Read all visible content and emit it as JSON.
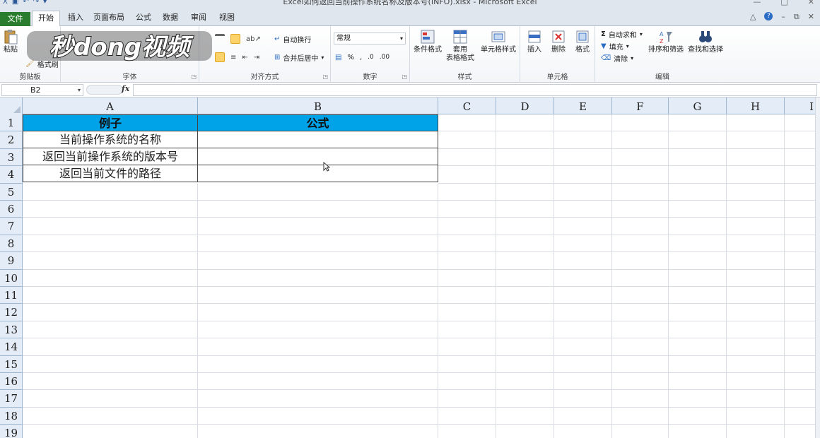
{
  "window": {
    "title": "Excel如何返回当前操作系统名称及版本号(INFO).xlsx - Microsoft Excel",
    "controls": [
      "—",
      "□",
      "✕"
    ]
  },
  "tabs": {
    "file": "文件",
    "items": [
      "开始",
      "插入",
      "页面布局",
      "公式",
      "数据",
      "审阅",
      "视图"
    ]
  },
  "watermark": {
    "text": "秒dong视频"
  },
  "ribbon": {
    "clipboard": {
      "label": "剪贴板",
      "paste": "粘贴",
      "format_painter": "格式刷"
    },
    "font": {
      "label": "字体"
    },
    "alignment": {
      "label": "对齐方式",
      "wrap": "自动换行",
      "merge": "合并后居中"
    },
    "number": {
      "label": "数字",
      "format": "常规"
    },
    "styles": {
      "label": "样式",
      "conditional": "条件格式",
      "table1": "套用",
      "table2": "表格格式",
      "cell_styles": "单元格样式"
    },
    "cells": {
      "label": "单元格",
      "insert": "插入",
      "delete": "删除",
      "format": "格式"
    },
    "editing": {
      "label": "编辑",
      "autosum": "自动求和",
      "fill": "填充",
      "clear": "清除",
      "sort": "排序和筛选",
      "find": "查找和选择"
    }
  },
  "formula_bar": {
    "name_box": "B2",
    "fx": "fx",
    "value": ""
  },
  "sheet": {
    "columns": [
      "A",
      "B",
      "C",
      "D",
      "E",
      "F",
      "G",
      "H",
      "I"
    ],
    "rows": [
      "1",
      "2",
      "3",
      "4",
      "5",
      "6",
      "7",
      "8",
      "9",
      "10",
      "11",
      "12",
      "13",
      "14",
      "15",
      "16",
      "17",
      "18",
      "19"
    ],
    "cells": {
      "A1": "例子",
      "B1": "公式",
      "A2": "当前操作系统的名称",
      "A3": "返回当前操作系统的版本号",
      "A4": "返回当前文件的路径"
    },
    "colors": {
      "header_fill": "#00a2e8",
      "file_tab": "#2a7d2e"
    }
  }
}
